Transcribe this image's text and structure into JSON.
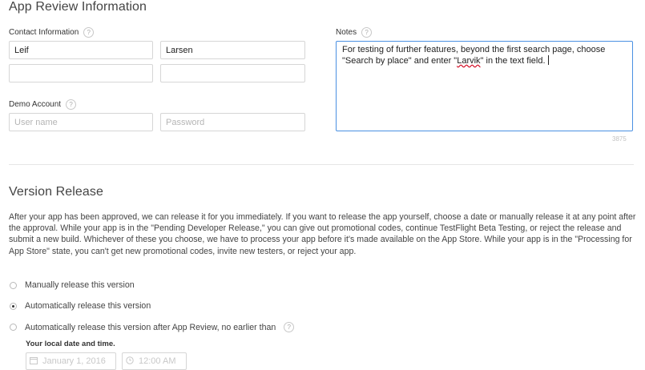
{
  "app_review": {
    "title": "App Review Information",
    "contact": {
      "label": "Contact Information",
      "help": "?",
      "first_name": "Leif",
      "last_name": "Larsen",
      "phone": "",
      "email": ""
    },
    "demo": {
      "label": "Demo Account",
      "help": "?",
      "username_placeholder": "User name",
      "password_placeholder": "Password"
    },
    "notes": {
      "label": "Notes",
      "help": "?",
      "text_before": "For testing of further features, beyond the first search page, choose \"Search by place\" and enter \"",
      "text_misspelled": "Larvik",
      "text_after": "\" in the text field.",
      "counter": "3875"
    }
  },
  "version_release": {
    "title": "Version Release",
    "description": "After your app has been approved, we can release it for you immediately. If you want to release the app yourself, choose a date or manually release it at any point after the approval. While your app is in the \"Pending Developer Release,\" you can give out promotional codes, continue TestFlight Beta Testing, or reject the release and submit a new build. Whichever of these you choose, we have to process your app before it's made available on the App Store. While your app is in the \"Processing for App Store\" state, you can't get new promotional codes, invite new testers, or reject your app.",
    "options": [
      {
        "label": "Manually release this version",
        "selected": false
      },
      {
        "label": "Automatically release this version",
        "selected": true
      },
      {
        "label": "Automatically release this version after App Review, no earlier than",
        "selected": false,
        "help": "?"
      }
    ],
    "local_date_label": "Your local date and time.",
    "date_value": "January 1, 2016",
    "time_value": "12:00 AM",
    "calendar_icon": "calendar-icon",
    "clock_icon": "clock-icon"
  }
}
